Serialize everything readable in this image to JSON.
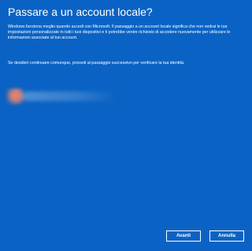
{
  "dialog": {
    "title": "Passare a un account locale?",
    "paragraph1": "Windows funziona meglio quando accedi con Microsoft. Il passaggio a un account locale significa che non vedrai le tue impostazioni personalizzate in tutti i tuoi dispositivi e ti potrebbe venire richiesto di accedere nuovamente per utilizzare le informazioni associate al tuo account.",
    "paragraph2": "Se desideri continuare comunque, procedi al passaggio successivo per verificare la tua identità."
  },
  "buttons": {
    "next_label": "Avanti",
    "cancel_label": "Annulla"
  },
  "colors": {
    "background": "#0a63c4",
    "text": "#ffffff"
  }
}
